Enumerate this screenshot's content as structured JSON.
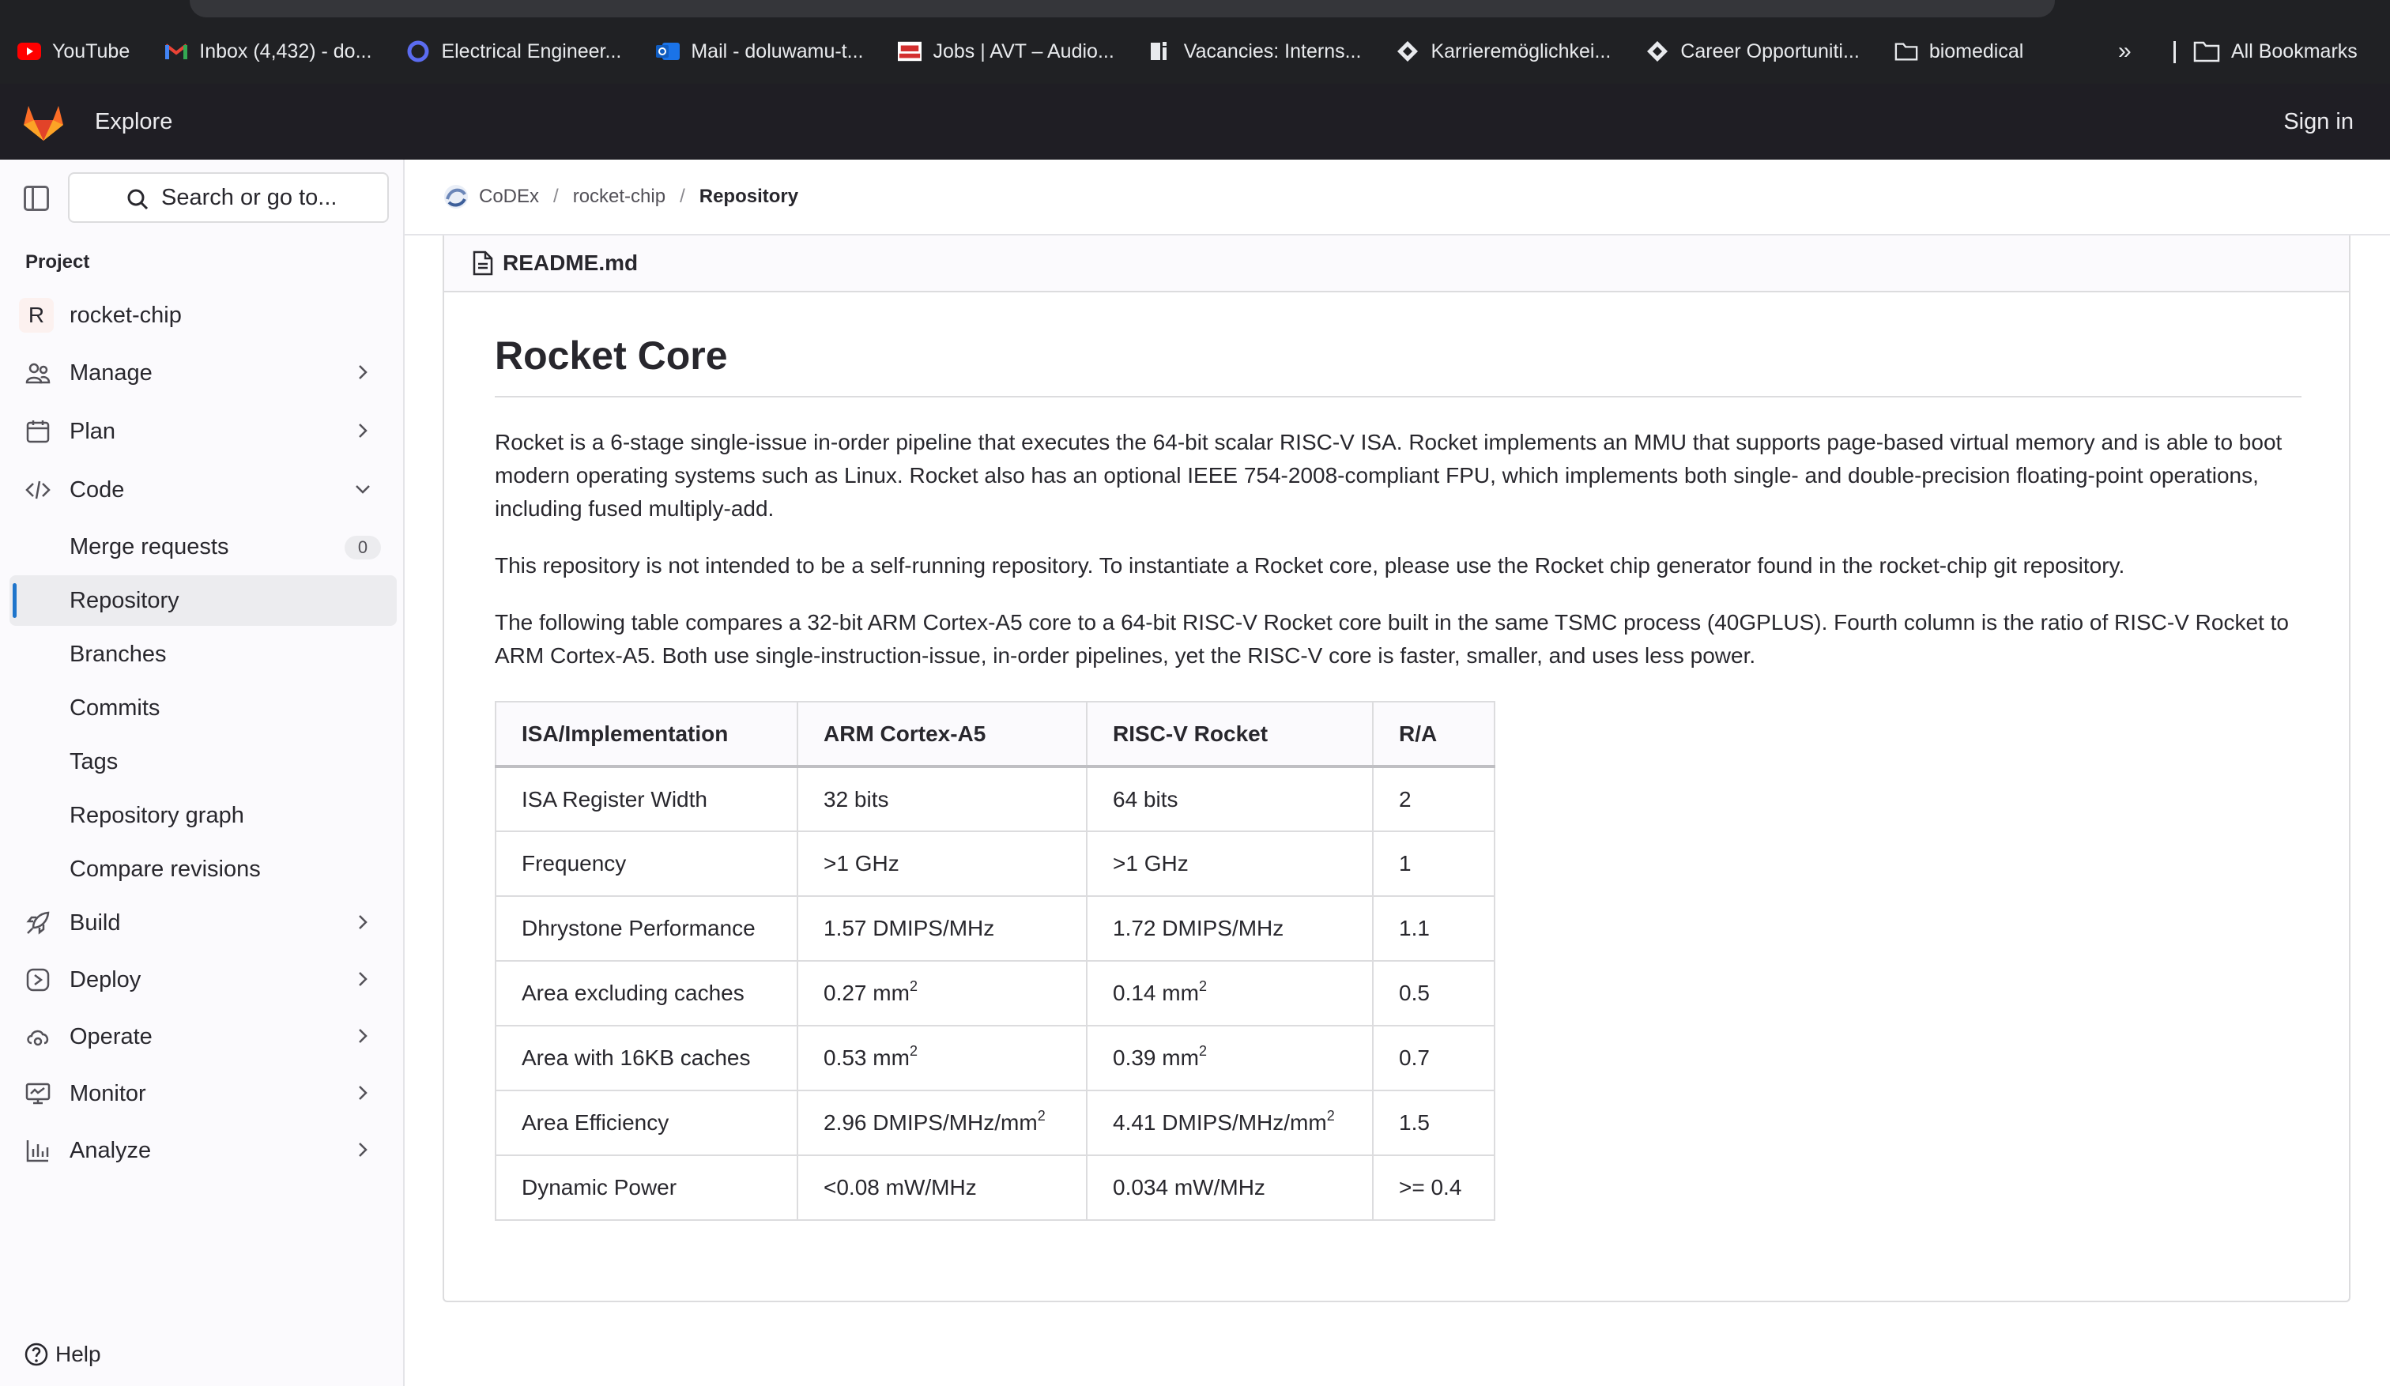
{
  "bookmarks": [
    {
      "label": "YouTube",
      "icon": "youtube-icon"
    },
    {
      "label": "Inbox (4,432) - do...",
      "icon": "gmail-icon"
    },
    {
      "label": "Electrical Engineer...",
      "icon": "circle-icon"
    },
    {
      "label": "Mail - doluwamu-t...",
      "icon": "outlook-icon"
    },
    {
      "label": "Jobs | AVT – Audio...",
      "icon": "avt-icon"
    },
    {
      "label": "Vacancies: Interns...",
      "icon": "si-icon"
    },
    {
      "label": "Karrieremöglichkei...",
      "icon": "diamond-icon"
    },
    {
      "label": "Career Opportuniti...",
      "icon": "diamond-icon"
    },
    {
      "label": "biomedical",
      "icon": "folder-icon"
    }
  ],
  "bookmarks_more": "»",
  "all_bookmarks": "All Bookmarks",
  "topnav": {
    "explore": "Explore",
    "sign_in": "Sign in"
  },
  "sidebar": {
    "search_label": "Search or go to...",
    "project_heading": "Project",
    "project_avatar": "R",
    "project_name": "rocket-chip",
    "nav": {
      "manage": "Manage",
      "plan": "Plan",
      "code": "Code",
      "merge_requests": "Merge requests",
      "merge_requests_count": "0",
      "repository": "Repository",
      "branches": "Branches",
      "commits": "Commits",
      "tags": "Tags",
      "repository_graph": "Repository graph",
      "compare_revisions": "Compare revisions",
      "build": "Build",
      "deploy": "Deploy",
      "operate": "Operate",
      "monitor": "Monitor",
      "analyze": "Analyze"
    },
    "help": "Help"
  },
  "breadcrumb": {
    "group": "CoDEx",
    "project": "rocket-chip",
    "current": "Repository",
    "sep": "/"
  },
  "readme": {
    "filename": "README.md",
    "title": "Rocket Core",
    "paragraphs": [
      "Rocket is a 6-stage single-issue in-order pipeline that executes the 64-bit scalar RISC-V ISA. Rocket implements an MMU that supports page-based virtual memory and is able to boot modern operating systems such as Linux. Rocket also has an optional IEEE 754-2008-compliant FPU, which implements both single- and double-precision floating-point operations, including fused multiply-add.",
      "This repository is not intended to be a self-running repository. To instantiate a Rocket core, please use the Rocket chip generator found in the rocket-chip git repository.",
      "The following table compares a 32-bit ARM Cortex-A5 core to a 64-bit RISC-V Rocket core built in the same TSMC process (40GPLUS). Fourth column is the ratio of RISC-V Rocket to ARM Cortex-A5. Both use single-instruction-issue, in-order pipelines, yet the RISC-V core is faster, smaller, and uses less power."
    ],
    "table": {
      "headers": [
        "ISA/Implementation",
        "ARM Cortex-A5",
        "RISC-V Rocket",
        "R/A"
      ],
      "rows": [
        [
          "ISA Register Width",
          "32 bits",
          "64 bits",
          "2"
        ],
        [
          "Frequency",
          ">1 GHz",
          ">1 GHz",
          "1"
        ],
        [
          "Dhrystone Performance",
          "1.57 DMIPS/MHz",
          "1.72 DMIPS/MHz",
          "1.1"
        ],
        [
          "Area excluding caches",
          "0.27 mm",
          "0.14 mm",
          "0.5"
        ],
        [
          "Area with 16KB caches",
          "0.53 mm",
          "0.39 mm",
          "0.7"
        ],
        [
          "Area Efficiency",
          "2.96 DMIPS/MHz/mm",
          "4.41 DMIPS/MHz/mm",
          "1.5"
        ],
        [
          "Dynamic Power",
          "<0.08 mW/MHz",
          "0.034 mW/MHz",
          ">= 0.4"
        ]
      ],
      "superscript": "2"
    }
  },
  "colors": {
    "accent": "#1f75cb",
    "topnav_bg": "#1f1e24",
    "gitlab_orange": "#fc6d26"
  }
}
